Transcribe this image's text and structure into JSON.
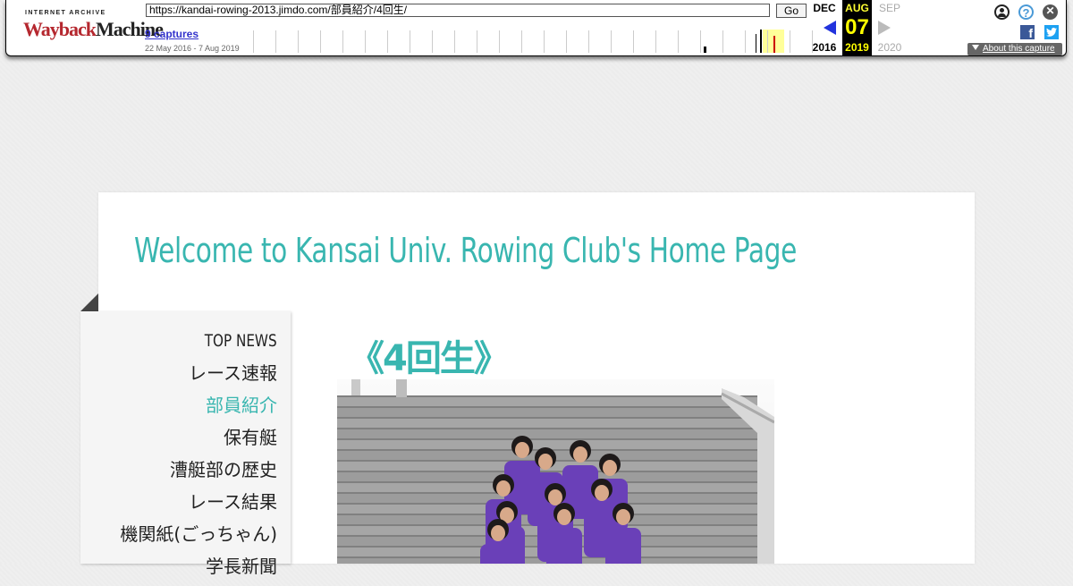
{
  "wayback": {
    "logo_top": "INTERNET ARCHIVE",
    "logo_main_a": "Wayback",
    "logo_main_b": "Machine",
    "url": "https://kandai-rowing-2013.jimdo.com/部員紹介/4回生/",
    "go_label": "Go",
    "captures_label": "9 captures",
    "date_range": "22 May 2016 - 7 Aug 2019",
    "prev": {
      "month": "DEC",
      "year": "2016"
    },
    "current": {
      "month": "AUG",
      "day": "07",
      "year": "2019"
    },
    "next": {
      "month": "SEP",
      "year": "2020"
    },
    "about_label": "About this capture",
    "help_glyph": "?",
    "close_glyph": "✕",
    "facebook_glyph": "f",
    "icons": [
      "user-icon",
      "help-icon",
      "close-icon",
      "facebook-icon",
      "twitter-icon"
    ]
  },
  "site": {
    "title": "Welcome to Kansai Univ. Rowing Club's Home Page",
    "accent_color": "#39b6b0"
  },
  "nav": {
    "items": [
      {
        "label": "TOP NEWS",
        "active": false
      },
      {
        "label": "レース速報",
        "active": false
      },
      {
        "label": "部員紹介",
        "active": true
      },
      {
        "label": "保有艇",
        "active": false
      },
      {
        "label": "漕艇部の歴史",
        "active": false
      },
      {
        "label": "レース結果",
        "active": false
      },
      {
        "label": "機関紙(ごっちゃん)",
        "active": false
      },
      {
        "label": "学長新聞",
        "active": false
      }
    ]
  },
  "content": {
    "heading": "《4回生》"
  }
}
